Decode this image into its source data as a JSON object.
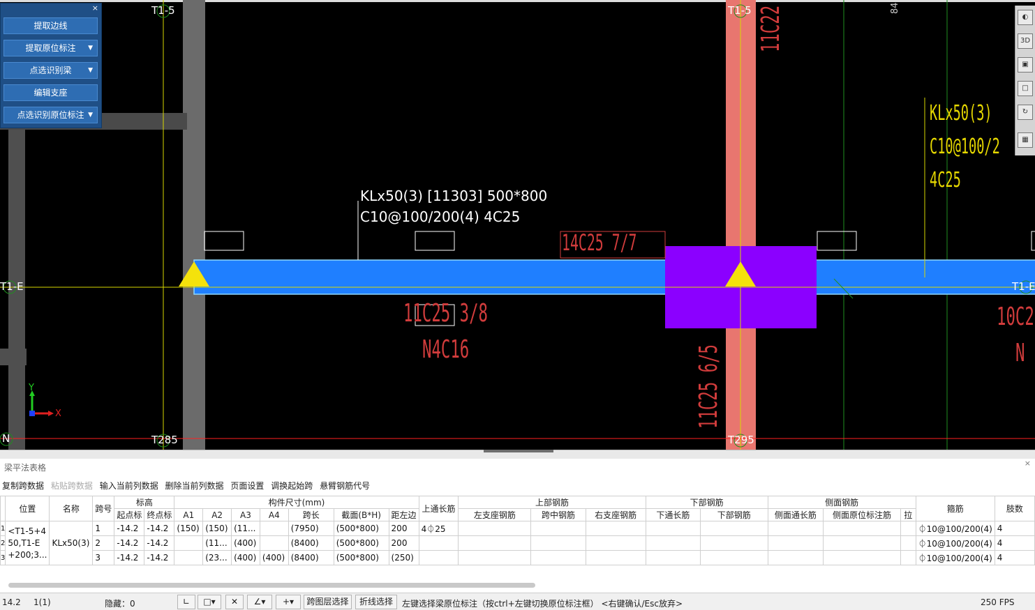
{
  "panel": {
    "close": "×",
    "buttons": [
      "提取边线",
      "提取原位标注",
      "点选识别梁",
      "编辑支座",
      "点选识别原位标注"
    ]
  },
  "canvas": {
    "axis_labels": {
      "t1_5_top_left": "T1-5",
      "t1_5_top_mid": "T1-5",
      "t1_e_left": "T1-E",
      "t1_e_right": "T1-E",
      "t285_bottom": "T285",
      "t295_bottom": "T295",
      "n_left": "N",
      "top_right_num": "84"
    },
    "beam_label_line1": "KLx50(3) [11303] 500*800",
    "beam_label_line2": "C10@100/200(4) 4C25",
    "right_label_line1": "KLx50(3)",
    "right_label_line2": "C10@100/2",
    "right_label_line3": "4C25",
    "red_top_mid": "14C25 7/7",
    "red_bottom_mid_line1": "11C25 3/8",
    "red_bottom_mid_line2": "N4C16",
    "red_vertical_low": "11C25 6/5",
    "red_vertical_top": "11C22",
    "red_right_line1": "10C2",
    "red_right_line2": "N",
    "ucs_y": "Y",
    "ucs_x": "X",
    "colors": {
      "beam": "#1f7fff",
      "column": "#e8766f",
      "support": "#8b00ff",
      "triangle": "#f4e20c",
      "axis": "#d8d800",
      "pink": "#d13c3c"
    }
  },
  "right_toolbar": [
    "globe-icon",
    "3d-icon",
    "cube-icon",
    "box-icon",
    "rotate-icon",
    "grid-icon"
  ],
  "table_panel": {
    "title": "梁平法表格",
    "close": "×",
    "toolbar": [
      "复制跨数据",
      "粘贴跨数据",
      "输入当前列数据",
      "删除当前列数据",
      "页面设置",
      "调换起始跨",
      "悬臂钢筋代号"
    ],
    "toolbar_disabled": [
      false,
      true,
      false,
      false,
      false,
      false,
      false
    ],
    "headers_top": {
      "position": "位置",
      "name": "名称",
      "span": "跨号",
      "elev": "标高",
      "size": "构件尺寸(mm)",
      "top_cont": "上通长筋",
      "top_rebar": "上部钢筋",
      "bot_rebar": "下部钢筋",
      "side_rebar": "侧面钢筋",
      "stirrup": "箍筋",
      "legs": "肢数"
    },
    "headers_sub": [
      "起点标",
      "终点标",
      "A1",
      "A2",
      "A3",
      "A4",
      "跨长",
      "截面(B*H)",
      "距左边",
      "左支座钢筋",
      "跨中钢筋",
      "右支座钢筋",
      "下通长筋",
      "下部钢筋",
      "侧面通长筋",
      "侧面原位标注筋",
      "拉"
    ],
    "row_index": [
      "1",
      "2",
      "3"
    ],
    "position": "<T1-5+4\n50,T1-E\n+200;3...",
    "name": "KLx50(3)",
    "rows": [
      {
        "span": "1",
        "start": "-14.2",
        "end": "-14.2",
        "a1": "(150)",
        "a2": "(150)",
        "a3": "(11...",
        "a4": "",
        "len": "(7950)",
        "sec": "(500*800)",
        "dist": "200",
        "topcont": "4⏀25",
        "stirrup": "⏀10@100/200(4)",
        "legs": "4"
      },
      {
        "span": "2",
        "start": "-14.2",
        "end": "-14.2",
        "a1": "",
        "a2": "(11...",
        "a3": "(400)",
        "a4": "",
        "len": "(8400)",
        "sec": "(500*800)",
        "dist": "200",
        "topcont": "",
        "stirrup": "⏀10@100/200(4)",
        "legs": "4"
      },
      {
        "span": "3",
        "start": "-14.2",
        "end": "-14.2",
        "a1": "",
        "a2": "(23...",
        "a3": "(400)",
        "a4": "(400)",
        "len": "(8400)",
        "sec": "(500*800)",
        "dist": "(250)",
        "topcont": "",
        "stirrup": "⏀10@100/200(4)",
        "legs": "4"
      }
    ]
  },
  "status": {
    "elev": "14.2",
    "layer": "1(1)",
    "hidden": "隐藏：0",
    "btn_cross": "跨图层选择",
    "btn_poly": "折线选择",
    "hint": "左键选择梁原位标注（按ctrl+左键切换原位标注框） <右键确认/Esc放弃>",
    "fps": "250 FPS"
  }
}
